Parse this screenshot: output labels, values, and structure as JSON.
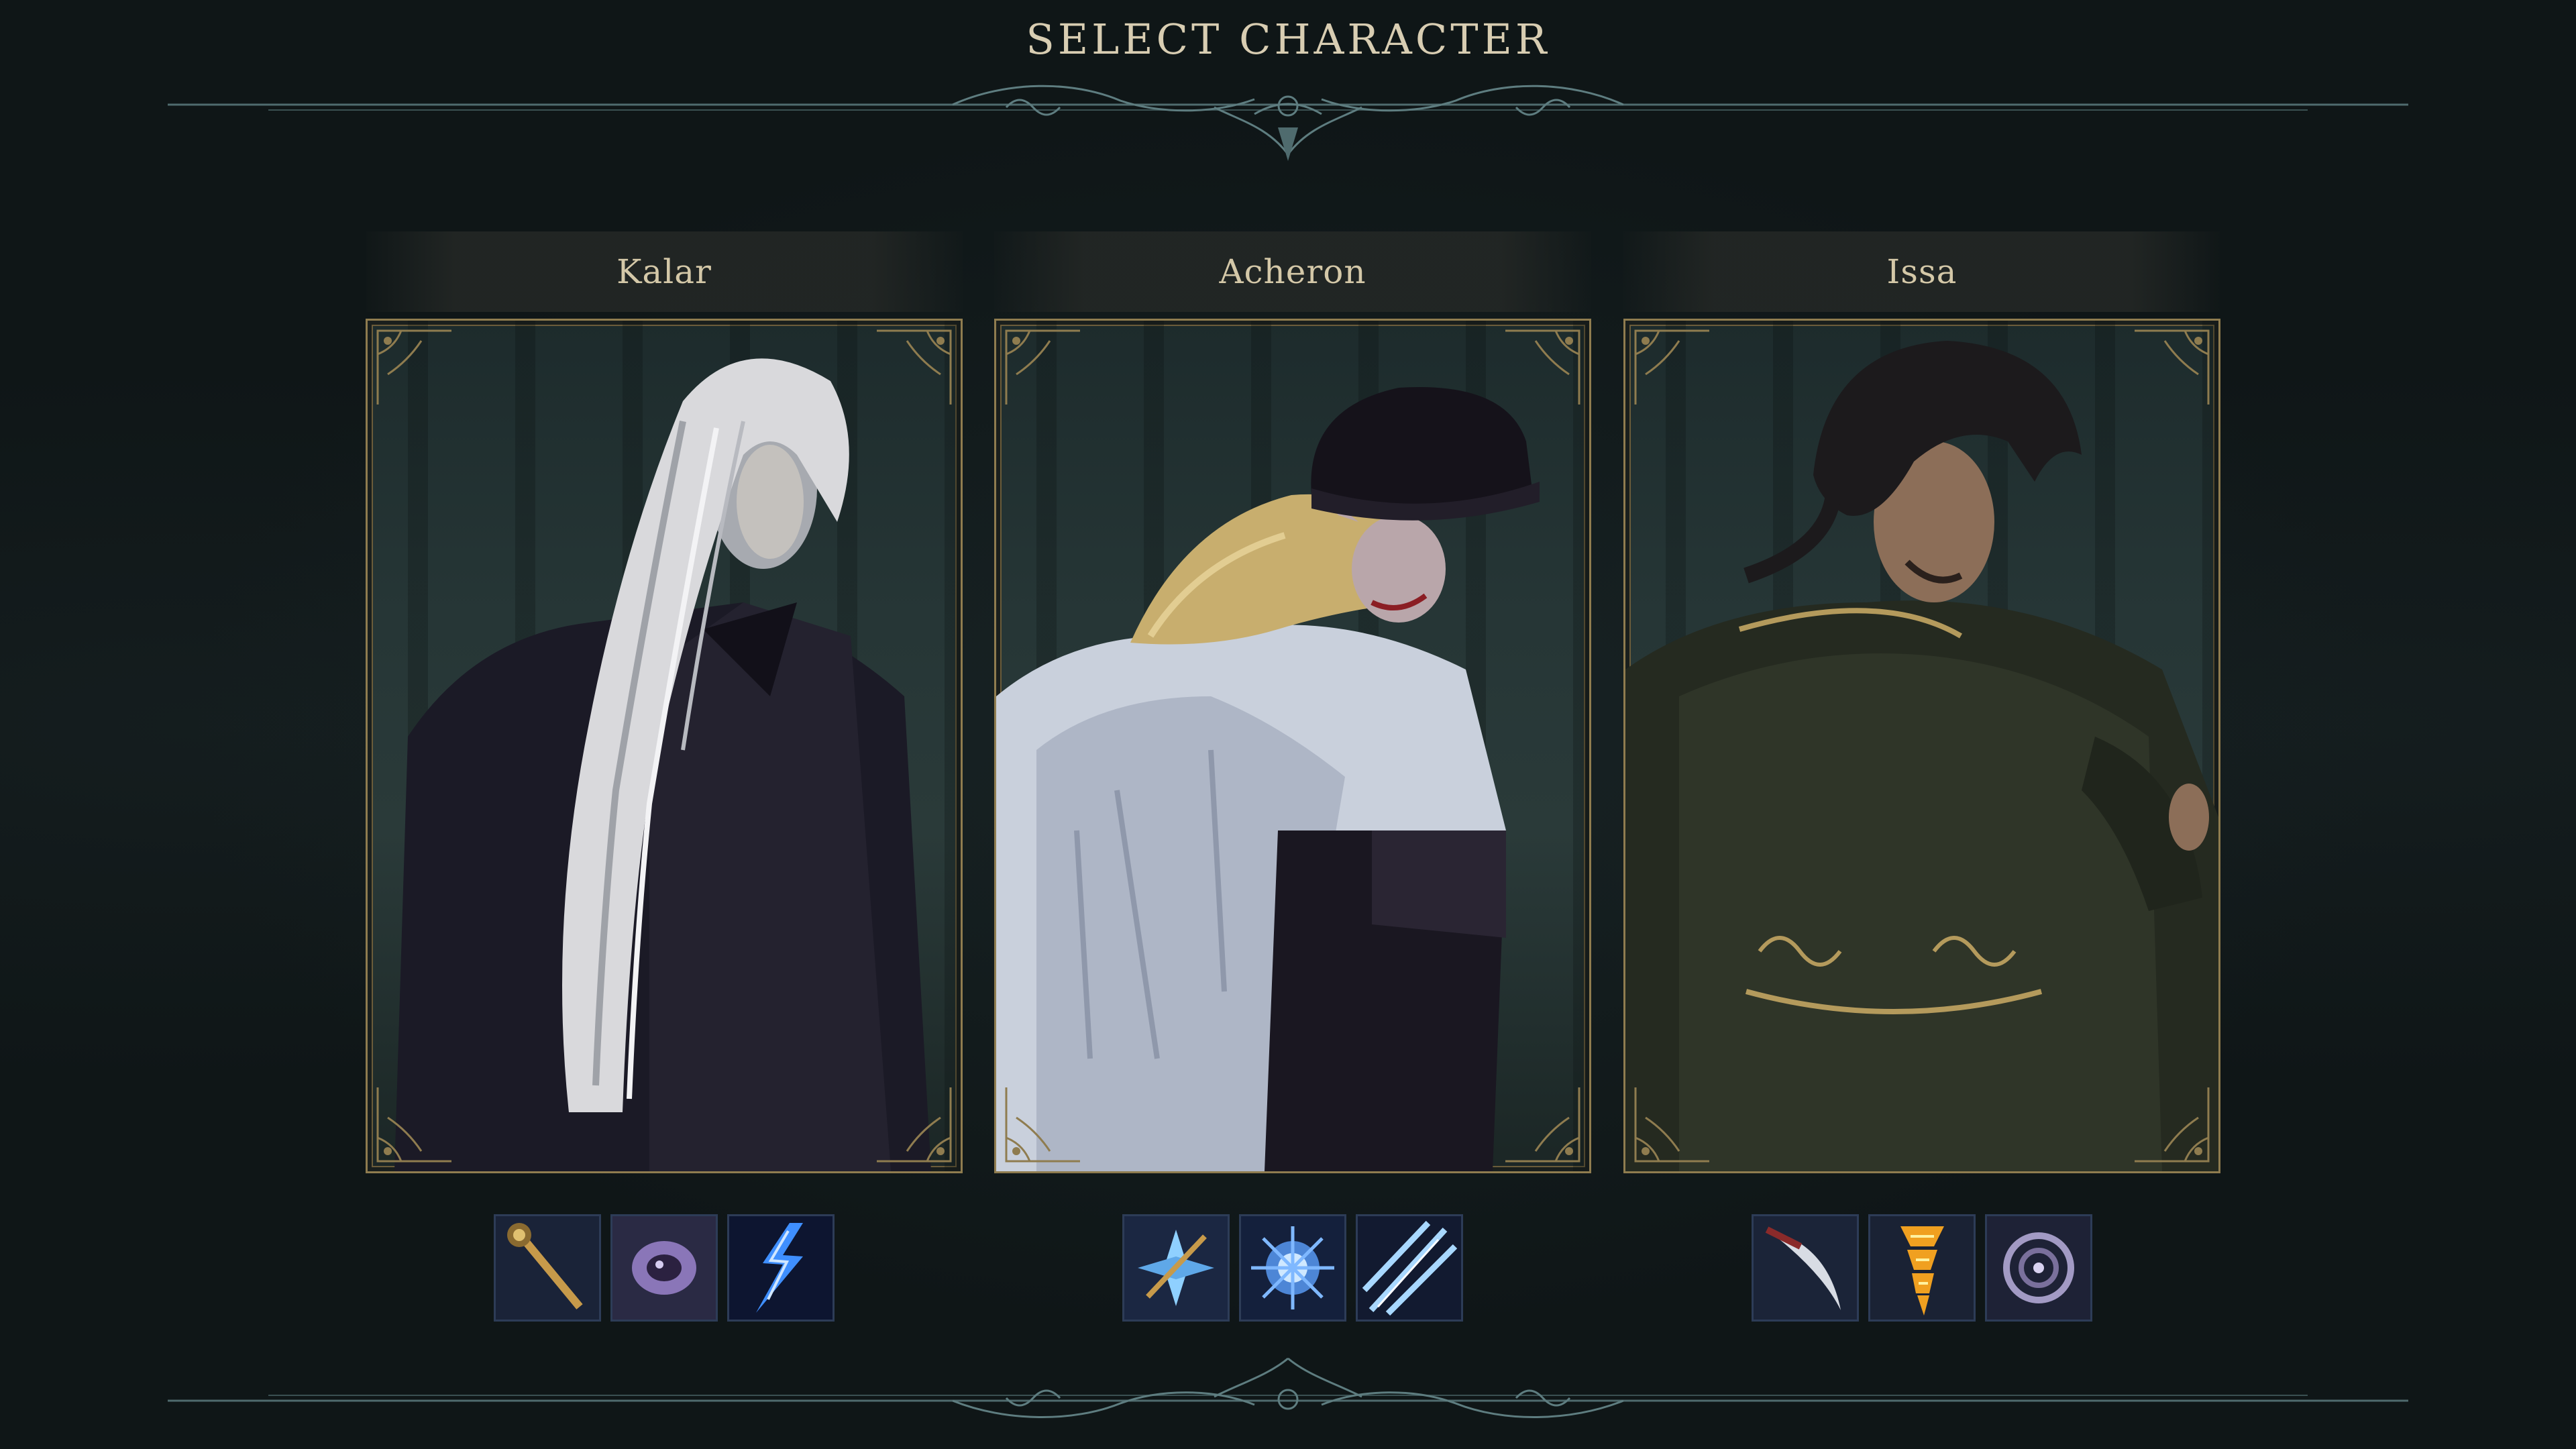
{
  "screen": {
    "title": "SELECT CHARACTER"
  },
  "characters": [
    {
      "name": "Kalar",
      "abilities": [
        {
          "icon": "golden-staff-icon",
          "color": "#c79a4a"
        },
        {
          "icon": "shadow-orb-icon",
          "color": "#8a76b8"
        },
        {
          "icon": "lightning-bolt-icon",
          "color": "#3f8fff"
        }
      ]
    },
    {
      "name": "Acheron",
      "abilities": [
        {
          "icon": "ice-crystal-icon",
          "color": "#8fd0ff"
        },
        {
          "icon": "frost-burst-icon",
          "color": "#7fb8ff"
        },
        {
          "icon": "slash-streaks-icon",
          "color": "#a8d8ff"
        }
      ]
    },
    {
      "name": "Issa",
      "abilities": [
        {
          "icon": "curved-blade-icon",
          "color": "#d8dce4"
        },
        {
          "icon": "fire-tornado-icon",
          "color": "#f0a020"
        },
        {
          "icon": "dark-vortex-icon",
          "color": "#a29ac4"
        }
      ]
    }
  ],
  "colors": {
    "background": "#0f1617",
    "title_text": "#d8cdb2",
    "frame_gold": "#8f7c4f",
    "divider_line": "#5e7d80"
  }
}
